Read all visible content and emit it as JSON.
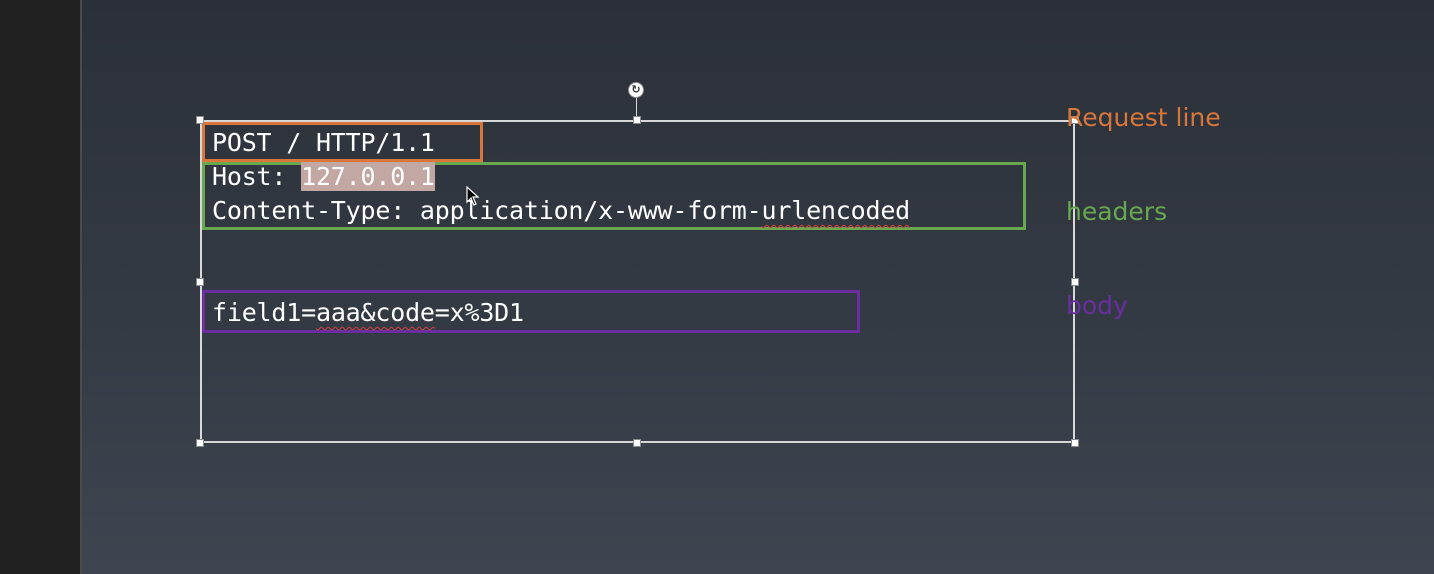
{
  "http_request": {
    "request_line": "POST / HTTP/1.1",
    "host_label": "Host: ",
    "host_value": "127.0.0.1",
    "content_type_prefix": "Content-Type: ",
    "content_type_value_1": "application/x-www-form-",
    "content_type_value_2": "urlencoded",
    "body_part1": "field1=",
    "body_part2": "aaa&code",
    "body_part3": "=x%3D1"
  },
  "labels": {
    "request_line": "Request line",
    "headers": "headers",
    "body": "body"
  },
  "colors": {
    "request_line": "#d9763b",
    "headers": "#6aa84f",
    "body": "#6a2ea0",
    "selection_highlight": "#c3a7a2"
  },
  "icons": {
    "rotate_handle": "rotate-icon",
    "cursor": "mouse-pointer-icon"
  }
}
